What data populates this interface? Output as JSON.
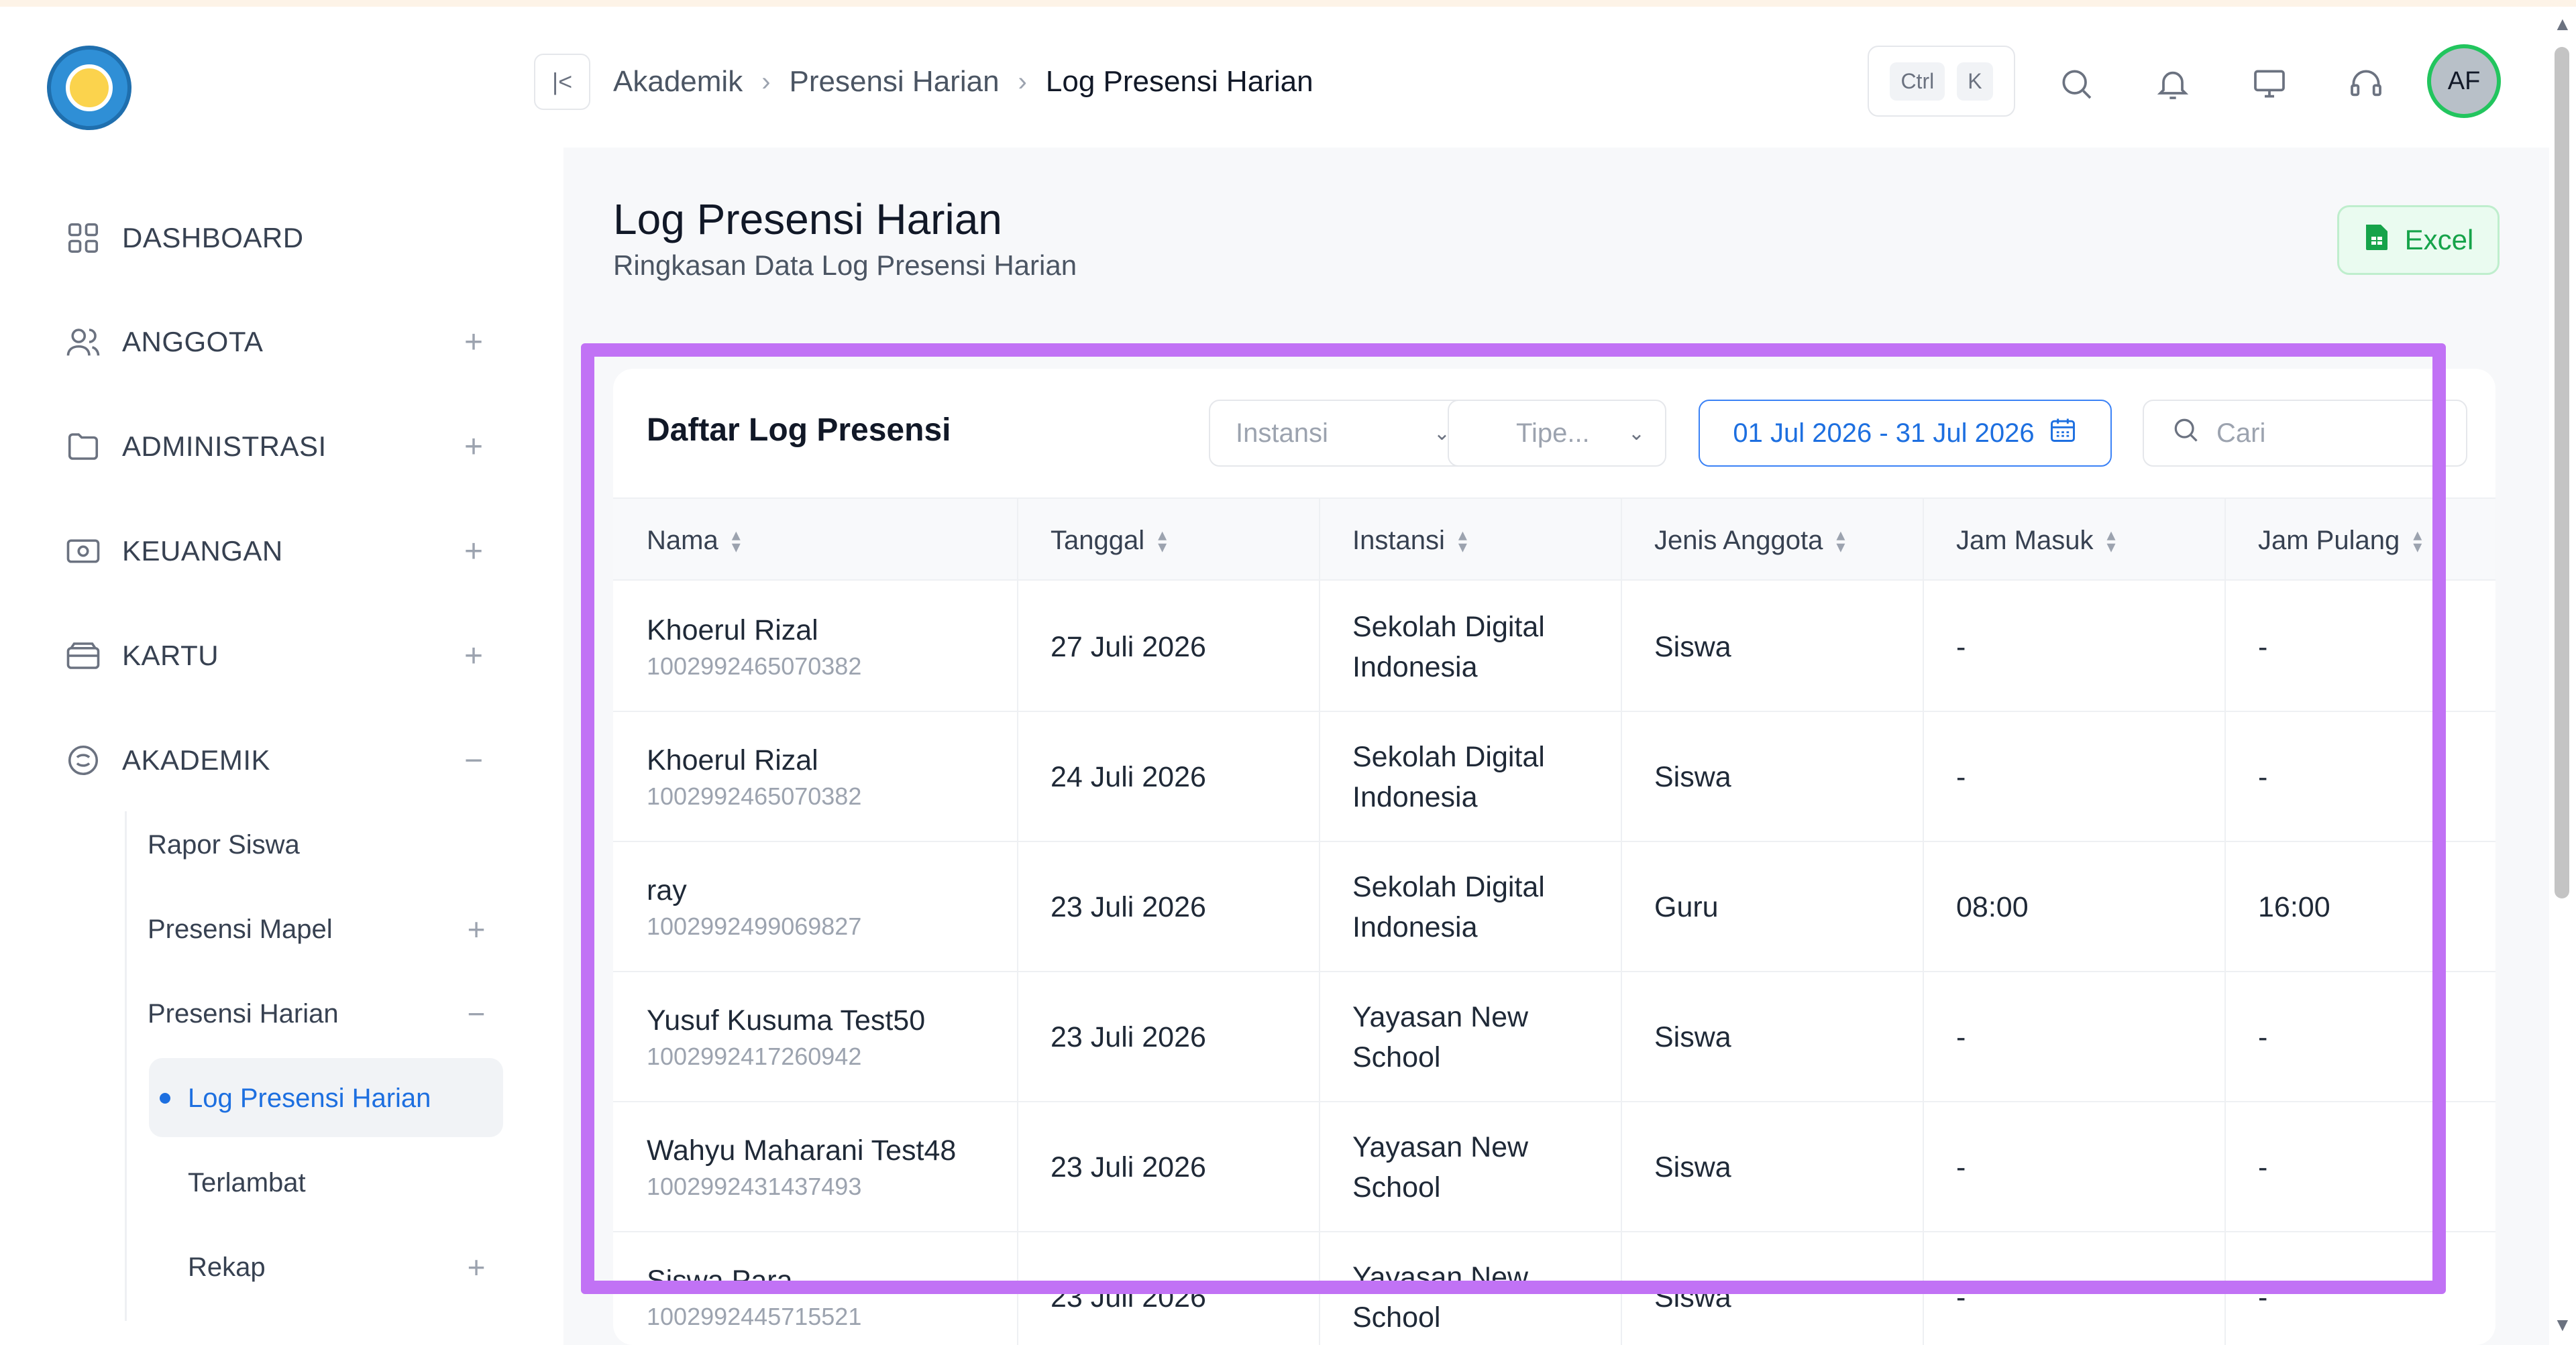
{
  "sidebar": {
    "items": [
      {
        "label": "DASHBOARD",
        "icon": "grid-icon",
        "toggle": ""
      },
      {
        "label": "ANGGOTA",
        "icon": "users-icon",
        "toggle": "+"
      },
      {
        "label": "ADMINISTRASI",
        "icon": "folder-icon",
        "toggle": "+"
      },
      {
        "label": "KEUANGAN",
        "icon": "money-icon",
        "toggle": "+"
      },
      {
        "label": "KARTU",
        "icon": "card-icon",
        "toggle": "+"
      },
      {
        "label": "AKADEMIK",
        "icon": "academic-icon",
        "toggle": "−"
      }
    ],
    "akademik_sub": [
      {
        "label": "Rapor Siswa",
        "toggle": ""
      },
      {
        "label": "Presensi Mapel",
        "toggle": "+"
      },
      {
        "label": "Presensi Harian",
        "toggle": "−"
      }
    ],
    "presensi_harian_sub": [
      {
        "label": "Log Presensi Harian",
        "toggle": "",
        "active": true
      },
      {
        "label": "Terlambat",
        "toggle": ""
      },
      {
        "label": "Rekap",
        "toggle": "+"
      }
    ]
  },
  "header": {
    "collapse_icon": "|<",
    "breadcrumb": [
      "Akademik",
      "Presensi Harian",
      "Log Presensi Harian"
    ],
    "shortcut": [
      "Ctrl",
      "K"
    ],
    "avatar": "AF"
  },
  "page": {
    "title": "Log Presensi Harian",
    "subtitle": "Ringkasan Data Log Presensi Harian",
    "excel_label": "Excel"
  },
  "card": {
    "title": "Daftar Log Presensi",
    "filters": {
      "instansi": "Instansi",
      "tipe": "Tipe...",
      "date_range": "01 Jul 2026 - 31 Jul 2026",
      "search_placeholder": "Cari"
    },
    "columns": [
      "Nama",
      "Tanggal",
      "Instansi",
      "Jenis Anggota",
      "Jam Masuk",
      "Jam Pulang"
    ],
    "rows": [
      {
        "nama": "Khoerul Rizal",
        "id": "1002992465070382",
        "tanggal": "27 Juli 2026",
        "instansi1": "Sekolah Digital",
        "instansi2": "Indonesia",
        "jenis": "Siswa",
        "masuk": "-",
        "pulang": "-"
      },
      {
        "nama": "Khoerul Rizal",
        "id": "1002992465070382",
        "tanggal": "24 Juli 2026",
        "instansi1": "Sekolah Digital",
        "instansi2": "Indonesia",
        "jenis": "Siswa",
        "masuk": "-",
        "pulang": "-"
      },
      {
        "nama": "ray",
        "id": "1002992499069827",
        "tanggal": "23 Juli 2026",
        "instansi1": "Sekolah Digital",
        "instansi2": "Indonesia",
        "jenis": "Guru",
        "masuk": "08:00",
        "pulang": "16:00"
      },
      {
        "nama": "Yusuf Kusuma Test50",
        "id": "1002992417260942",
        "tanggal": "23 Juli 2026",
        "instansi1": "Yayasan New",
        "instansi2": "School",
        "jenis": "Siswa",
        "masuk": "-",
        "pulang": "-"
      },
      {
        "nama": "Wahyu Maharani Test48",
        "id": "1002992431437493",
        "tanggal": "23 Juli 2026",
        "instansi1": "Yayasan New",
        "instansi2": "School",
        "jenis": "Siswa",
        "masuk": "-",
        "pulang": "-"
      },
      {
        "nama": "Siswa Para",
        "id": "1002992445715521",
        "tanggal": "23 Juli 2026",
        "instansi1": "Yayasan New",
        "instansi2": "School",
        "jenis": "Siswa",
        "masuk": "-",
        "pulang": "-"
      }
    ]
  },
  "colors": {
    "accent": "#1d6fe0",
    "highlight": "#c172f5",
    "excel": "#16a34a",
    "avatar_ring": "#22c55e"
  }
}
